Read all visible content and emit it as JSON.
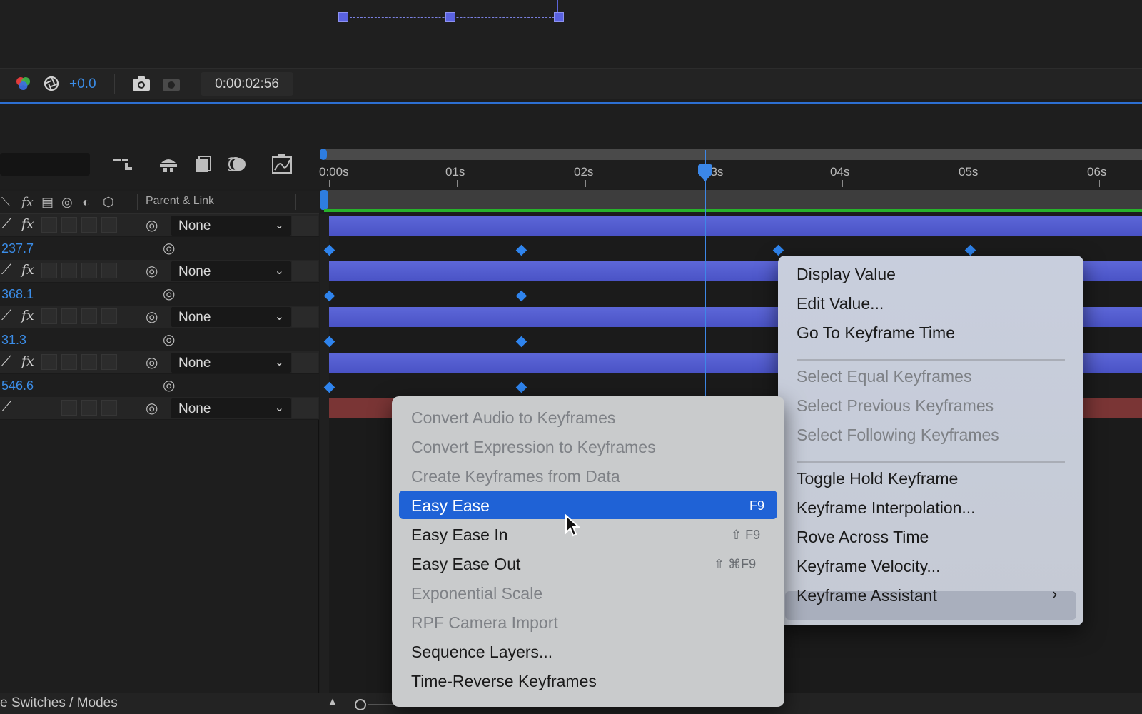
{
  "viewer_toolbar": {
    "exposure_value": "+0.0",
    "timecode": "0:00:02:56"
  },
  "timeline": {
    "column_header": {
      "parent_link_label": "Parent & Link"
    },
    "ruler_ticks": [
      "0:00s",
      "01s",
      "02s",
      "03s",
      "04s",
      "05s",
      "06s"
    ],
    "layers": [
      {
        "parent": "None",
        "property_value": "237.7"
      },
      {
        "parent": "None",
        "property_value": "368.1"
      },
      {
        "parent": "None",
        "property_value": "31.3"
      },
      {
        "parent": "None",
        "property_value": "546.6"
      },
      {
        "parent": "None",
        "property_value": ""
      }
    ],
    "footer_toggle_label": "e Switches / Modes"
  },
  "context_menu": {
    "items": [
      {
        "label": "Display Value",
        "enabled": true
      },
      {
        "label": "Edit Value...",
        "enabled": true
      },
      {
        "label": "Go To Keyframe Time",
        "enabled": true
      },
      {
        "label": "Select Equal Keyframes",
        "enabled": false
      },
      {
        "label": "Select Previous Keyframes",
        "enabled": false
      },
      {
        "label": "Select Following Keyframes",
        "enabled": false
      },
      {
        "label": "Toggle Hold Keyframe",
        "enabled": true
      },
      {
        "label": "Keyframe Interpolation...",
        "enabled": true
      },
      {
        "label": "Rove Across Time",
        "enabled": true
      },
      {
        "label": "Keyframe Velocity...",
        "enabled": true
      },
      {
        "label": "Keyframe Assistant",
        "enabled": true,
        "submenu": true
      }
    ]
  },
  "submenu": {
    "items": [
      {
        "label": "Convert Audio to Keyframes",
        "enabled": false,
        "shortcut": ""
      },
      {
        "label": "Convert Expression to Keyframes",
        "enabled": false,
        "shortcut": ""
      },
      {
        "label": "Create Keyframes from Data",
        "enabled": false,
        "shortcut": ""
      },
      {
        "label": "Easy Ease",
        "enabled": true,
        "shortcut": "F9",
        "highlighted": true
      },
      {
        "label": "Easy Ease In",
        "enabled": true,
        "shortcut": "⇧ F9"
      },
      {
        "label": "Easy Ease Out",
        "enabled": true,
        "shortcut": "⇧ ⌘F9"
      },
      {
        "label": "Exponential Scale",
        "enabled": false,
        "shortcut": ""
      },
      {
        "label": "RPF Camera Import",
        "enabled": false,
        "shortcut": ""
      },
      {
        "label": "Sequence Layers...",
        "enabled": true,
        "shortcut": ""
      },
      {
        "label": "Time-Reverse Keyframes",
        "enabled": true,
        "shortcut": ""
      }
    ]
  },
  "colors": {
    "accent_blue": "#2f84ee",
    "menu_highlight": "#1f62d6",
    "layer_bar": "#5a63d6",
    "work_area_green": "#27b22b"
  }
}
